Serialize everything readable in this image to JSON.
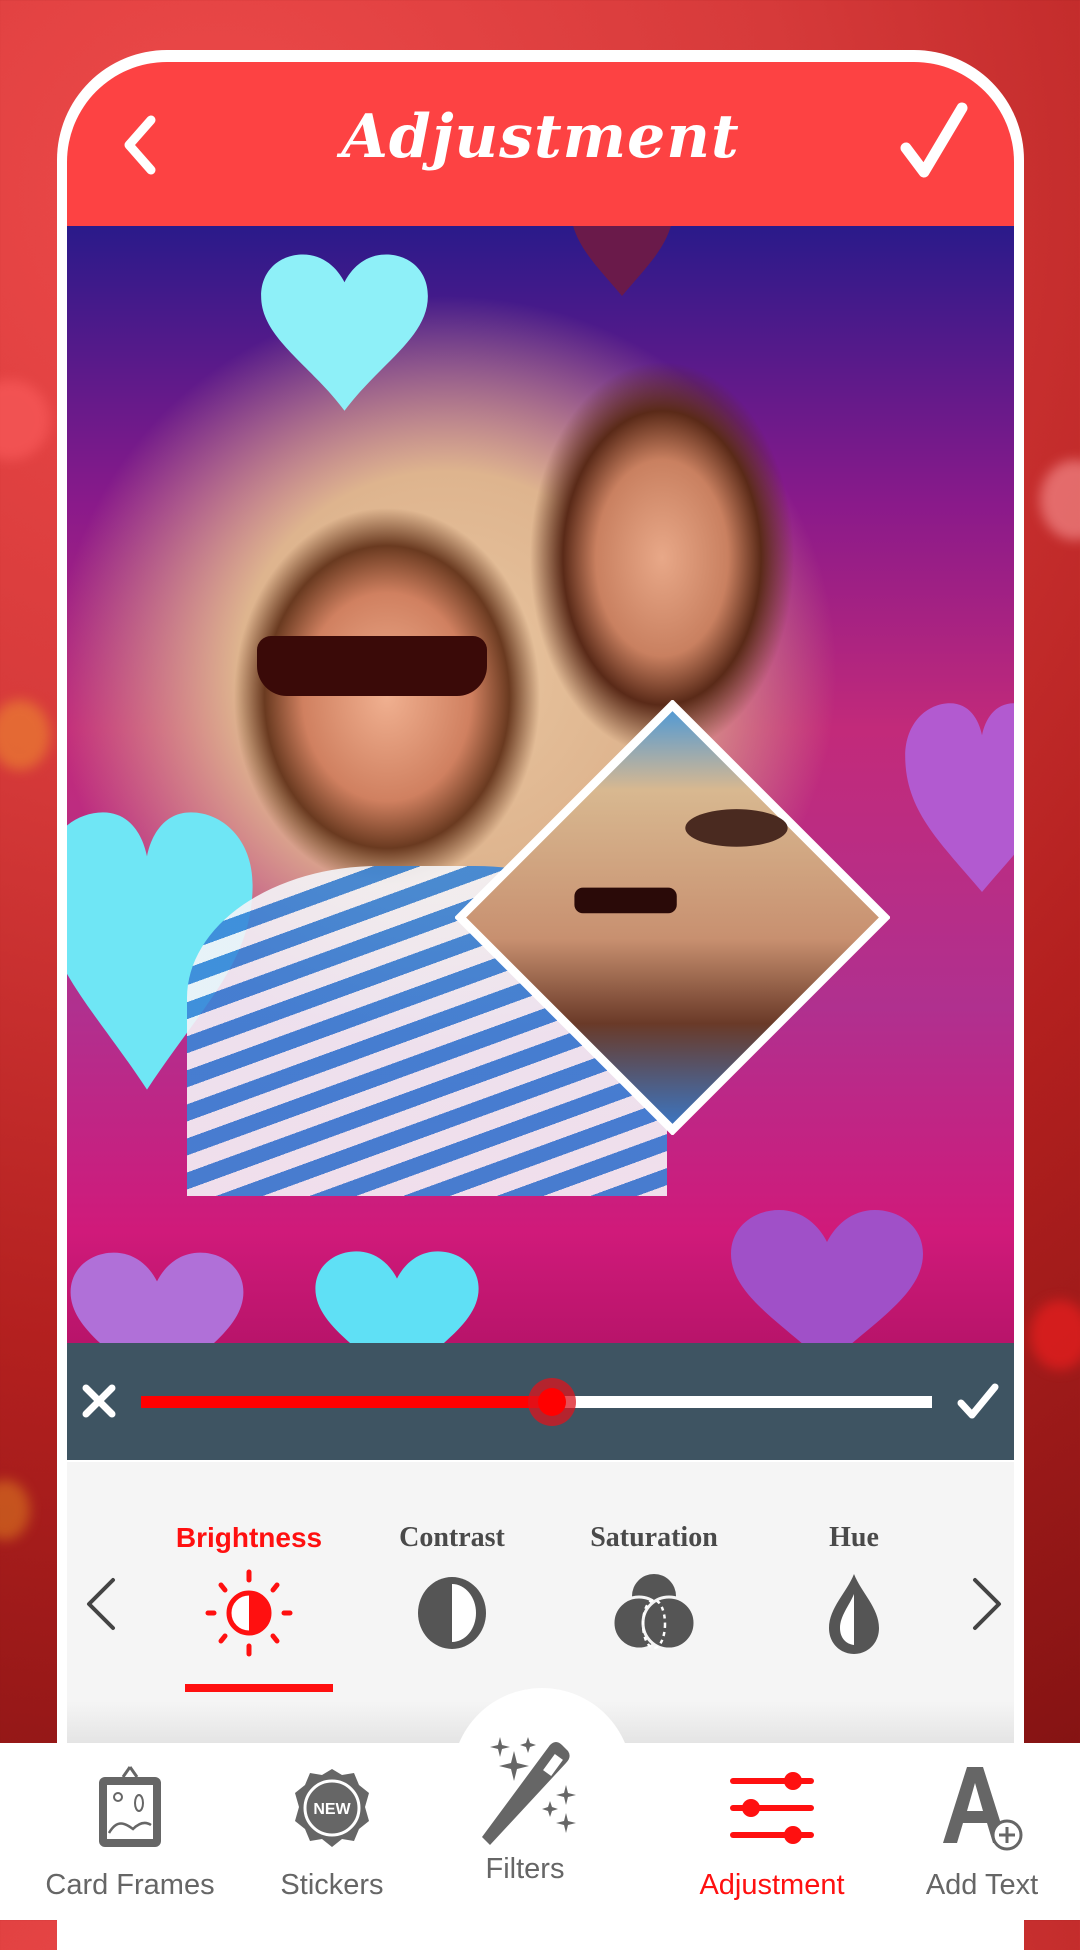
{
  "header": {
    "title": "Adjustment",
    "back_icon": "chevron-left-icon",
    "confirm_icon": "checkmark-icon",
    "color": "#fd4243"
  },
  "canvas": {
    "description": "Photo collage of a smiling couple with sunglasses on a heart-bokeh frame, plus a diamond-shaped inset photo"
  },
  "slider": {
    "cancel_icon": "close-icon",
    "apply_icon": "checkmark-icon",
    "value_fraction": 0.52,
    "fill_color": "#ff0000",
    "track_color": "#ffffff"
  },
  "adjust_tools": {
    "prev_icon": "chevron-left-icon",
    "next_icon": "chevron-right-icon",
    "active_index": 0,
    "items": [
      {
        "label": "Brightness",
        "icon": "brightness-icon"
      },
      {
        "label": "Contrast",
        "icon": "contrast-icon"
      },
      {
        "label": "Saturation",
        "icon": "saturation-icon"
      },
      {
        "label": "Hue",
        "icon": "hue-drop-icon"
      }
    ]
  },
  "bottom_nav": {
    "active_index": 3,
    "items": [
      {
        "label": "Card Frames",
        "icon": "picture-frame-icon"
      },
      {
        "label": "Stickers",
        "icon": "new-badge-icon",
        "badge_text": "NEW"
      },
      {
        "label": "Filters",
        "icon": "magic-wand-icon"
      },
      {
        "label": "Adjustment",
        "icon": "sliders-icon"
      },
      {
        "label": "Add Text",
        "icon": "add-text-icon"
      }
    ]
  },
  "colors": {
    "accent": "#ff1010",
    "icon_gray": "#555555"
  }
}
